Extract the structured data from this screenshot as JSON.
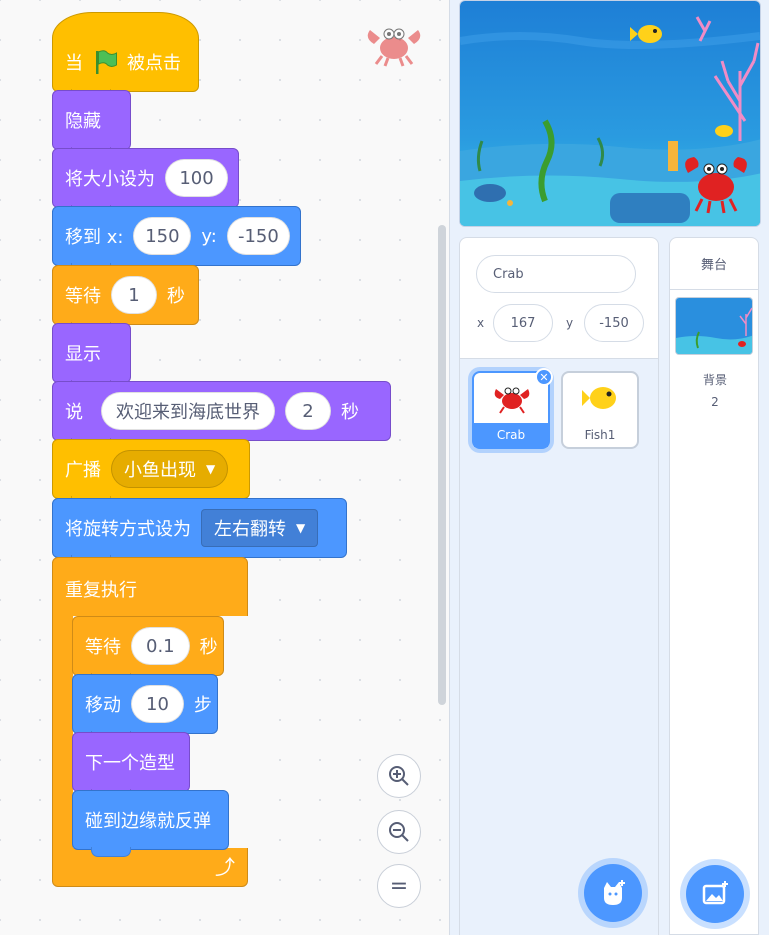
{
  "code_area": {
    "script": {
      "when_flag": {
        "prefix": "当",
        "suffix": "被点击"
      },
      "hide": "隐藏",
      "set_size": {
        "label": "将大小设为",
        "value": "100"
      },
      "go_to": {
        "label": "移到 x:",
        "x": "150",
        "y_label": "y:",
        "y": "-150"
      },
      "wait1": {
        "label": "等待",
        "value": "1",
        "unit": "秒"
      },
      "show": "显示",
      "say": {
        "label": "说",
        "message": "欢迎来到海底世界",
        "secs": "2",
        "unit": "秒"
      },
      "broadcast": {
        "label": "广播",
        "message": "小鱼出现"
      },
      "rotation": {
        "label": "将旋转方式设为",
        "value": "左右翻转"
      },
      "forever": {
        "label": "重复执行"
      },
      "wait2": {
        "label": "等待",
        "value": "0.1",
        "unit": "秒"
      },
      "move": {
        "label": "移动",
        "steps": "10",
        "unit": "步"
      },
      "next_costume": "下一个造型",
      "bounce": "碰到边缘就反弹"
    },
    "zoom": {
      "in_icon": "zoom-in-icon",
      "out_icon": "zoom-out-icon",
      "reset": "="
    }
  },
  "sprite_info": {
    "name": "Crab",
    "x_label": "x",
    "x": "167",
    "y_label": "y",
    "y": "-150"
  },
  "sprites": [
    {
      "name": "Crab",
      "selected": true
    },
    {
      "name": "Fish1",
      "selected": false
    }
  ],
  "stage_pane": {
    "title": "舞台",
    "backdrops_label": "背景",
    "backdrops_count": "2"
  },
  "colors": {
    "events": "#ffbf00",
    "looks": "#9966ff",
    "motion": "#4c97ff",
    "control": "#ffab19"
  }
}
